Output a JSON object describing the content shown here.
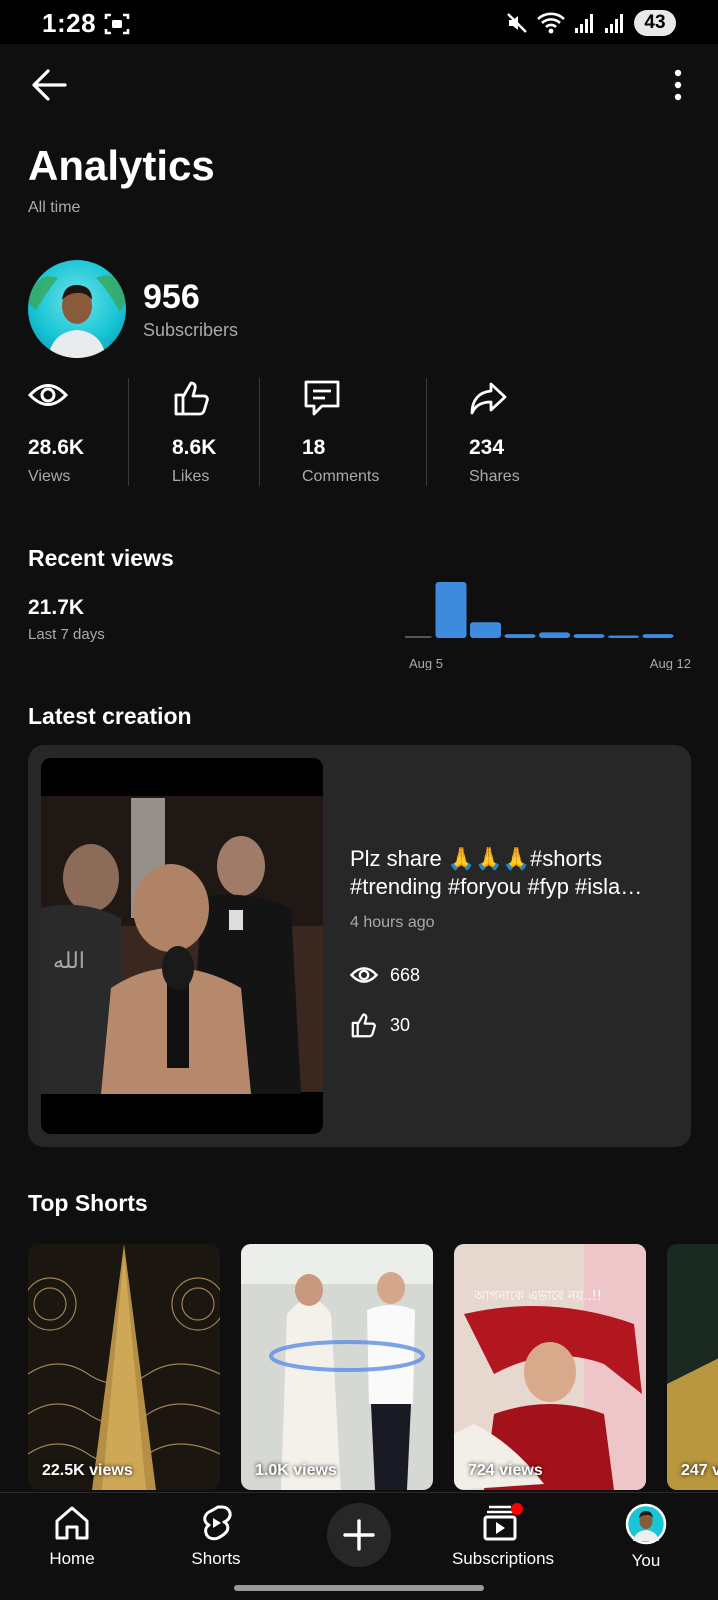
{
  "status_bar": {
    "time": "1:28",
    "battery": "43"
  },
  "header": {
    "title": "Analytics",
    "subtitle": "All time"
  },
  "channel": {
    "subscribers_count": "956",
    "subscribers_label": "Subscribers"
  },
  "stats": [
    {
      "icon": "eye-icon",
      "value": "28.6K",
      "label": "Views"
    },
    {
      "icon": "thumbs-up-icon",
      "value": "8.6K",
      "label": "Likes"
    },
    {
      "icon": "comment-icon",
      "value": "18",
      "label": "Comments"
    },
    {
      "icon": "share-icon",
      "value": "234",
      "label": "Shares"
    }
  ],
  "recent_views": {
    "heading": "Recent views",
    "value": "21.7K",
    "period": "Last 7 days",
    "axis_start": "Aug 5",
    "axis_end": "Aug 12"
  },
  "chart_data": {
    "type": "bar",
    "categories": [
      "",
      "",
      "",
      "",
      "",
      "",
      "",
      ""
    ],
    "values": [
      0.2,
      16,
      4.5,
      1.1,
      1.6,
      1.1,
      0.7,
      1.1
    ],
    "title": "",
    "xlabel": "",
    "ylabel": "",
    "x_tick_labels": [
      "Aug 5",
      "Aug 12"
    ],
    "bar_color": "#3e8bdd",
    "grid": false
  },
  "latest_creation": {
    "heading": "Latest creation",
    "title": "Plz share 🙏🙏🙏#shorts #trending #foryou #fyp #isla…",
    "time": "4 hours ago",
    "views": "668",
    "likes": "30"
  },
  "top_shorts": {
    "heading": "Top Shorts",
    "items": [
      {
        "views": "22.5K views"
      },
      {
        "views": "1.0K views"
      },
      {
        "views": "724 views"
      },
      {
        "views": "247 v"
      }
    ]
  },
  "nav": {
    "home": "Home",
    "shorts": "Shorts",
    "subscriptions": "Subscriptions",
    "you": "You"
  },
  "colors": {
    "background": "#0f0f0f",
    "card": "#272727",
    "accent": "#3e8bdd",
    "badge": "#ff0000"
  }
}
